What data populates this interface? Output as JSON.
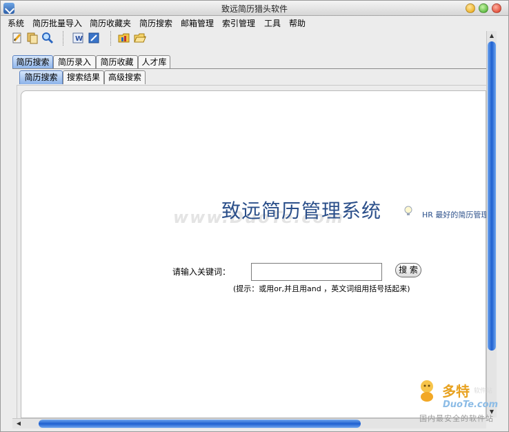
{
  "window": {
    "title": "致远简历猎头软件"
  },
  "menu": {
    "items": [
      "系统",
      "简历批量导入",
      "简历收藏夹",
      "简历搜索",
      "邮箱管理",
      "索引管理",
      "工具",
      "帮助"
    ]
  },
  "toolbar": {
    "icons": [
      "new-document-icon",
      "copy-icon",
      "search-icon",
      "word-icon",
      "edit-icon",
      "folder-chart-icon",
      "folder-open-icon"
    ]
  },
  "tabs": {
    "main": [
      "简历搜索",
      "简历录入",
      "简历收藏",
      "人才库"
    ],
    "active_main": "简历搜索",
    "sub": [
      "简历搜索",
      "搜索结果",
      "高级搜索"
    ],
    "active_sub": "简历搜索"
  },
  "search": {
    "system_title": "致远简历管理系统",
    "slogan": "HR 最好的简历管理",
    "keyword_label": "请输入关键词：",
    "keyword_value": "",
    "button_label": "搜 索",
    "hint": "(提示：或用or,并且用and ，英文词组用括号括起来)"
  },
  "watermarks": {
    "center": "www.DuoTe.com",
    "logo_cn": "多特",
    "logo_sub": "软件站",
    "logo_en": "DuoTe.com",
    "logo_tagline": "国内最安全的软件站"
  },
  "colors": {
    "accent": "#2b4f8a",
    "tab_active": "#8cb3ea",
    "scroll_thumb": "#1e5fd0"
  }
}
